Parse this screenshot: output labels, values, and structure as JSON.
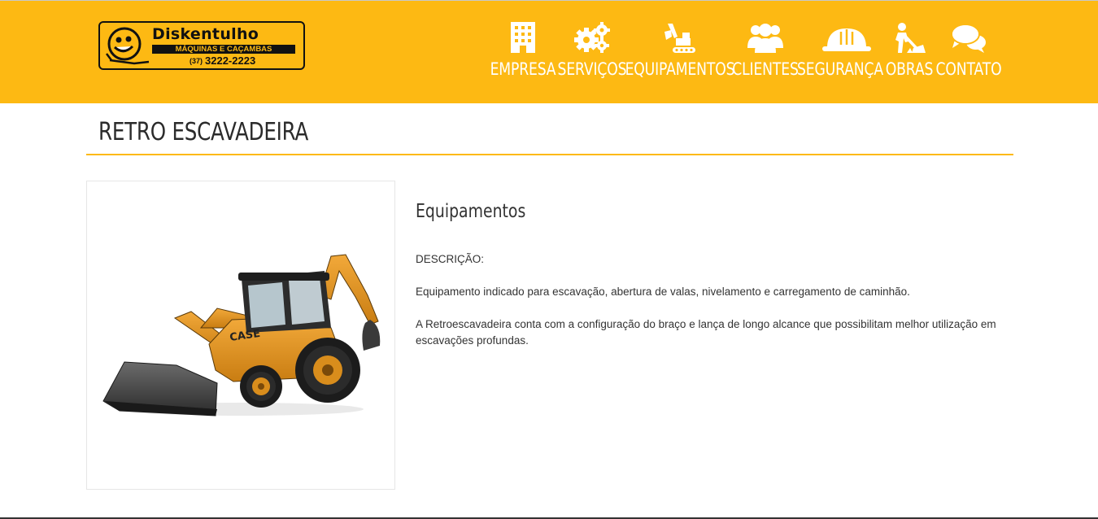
{
  "logo": {
    "name": "Diskentulho",
    "subtitle": "MÁQUINAS E CAÇAMBAS",
    "phone_ddd": "(37)",
    "phone": "3222-2223"
  },
  "nav": {
    "items": [
      {
        "label": "EMPRESA",
        "icon": "building-icon"
      },
      {
        "label": "SERVIÇOS",
        "icon": "gears-icon"
      },
      {
        "label": "EQUIPAMENTOS",
        "icon": "excavator-icon"
      },
      {
        "label": "CLIENTES",
        "icon": "users-icon"
      },
      {
        "label": "SEGURANÇA",
        "icon": "hard-hat-icon"
      },
      {
        "label": "OBRAS",
        "icon": "worker-digging-icon"
      },
      {
        "label": "CONTATO",
        "icon": "chat-bubbles-icon"
      }
    ]
  },
  "page": {
    "title": "RETRO ESCAVADEIRA",
    "section_heading": "Equipamentos",
    "desc_label": "DESCRIÇÃO:",
    "desc_p1": "Equipamento indicado para escavação, abertura de valas, nivelamento e carregamento de caminhão.",
    "desc_p2": "A Retroescavadeira conta com a configuração do braço e lança de longo alcance que possibilitam melhor utilização em escavações profundas.",
    "image_brand": "CASE"
  },
  "colors": {
    "brand_yellow": "#fdb913",
    "text_dark": "#333333",
    "nav_text": "#ffffff"
  }
}
